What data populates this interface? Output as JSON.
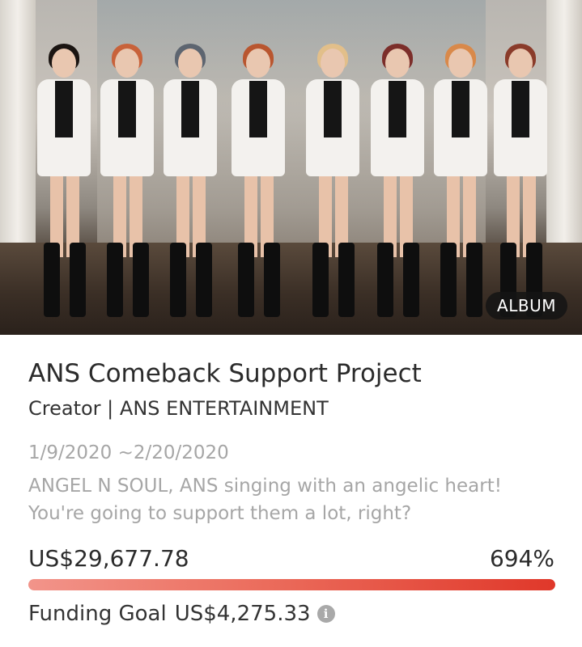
{
  "hero": {
    "badge": "ALBUM"
  },
  "project": {
    "title": "ANS Comeback Support Project",
    "creator_label": "Creator",
    "creator_separator": "|",
    "creator_name": "ANS ENTERTAINMENT",
    "date_range": "1/9/2020 ~2/20/2020",
    "description": "ANGEL N SOUL, ANS singing with an angelic heart! You're going to support them a lot, right?"
  },
  "funding": {
    "amount": "US$29,677.78",
    "percent": "694%",
    "progress_fraction": 1.0,
    "goal_label": "Funding Goal",
    "goal_value": "US$4,275.33",
    "info_icon": "info-icon"
  },
  "colors": {
    "progress_start": "#f2948a",
    "progress_end": "#e0382a",
    "secondary_text": "#a6a6a6"
  }
}
